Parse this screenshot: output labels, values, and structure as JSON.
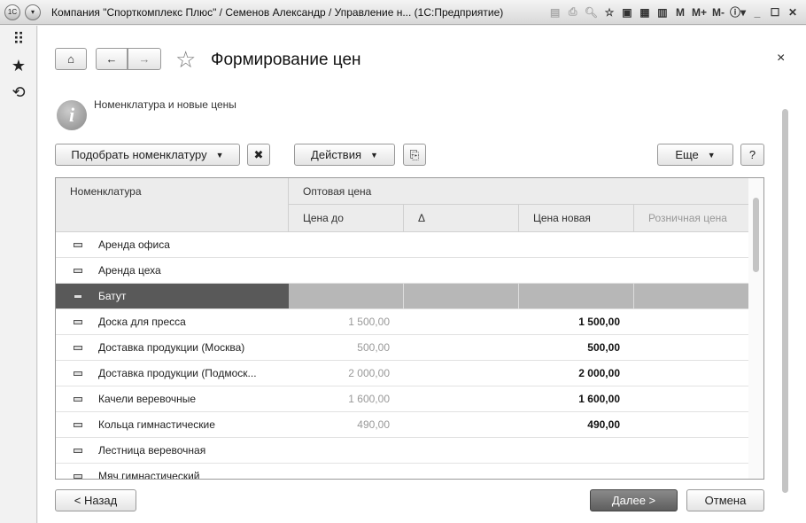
{
  "window": {
    "title": "Компания \"Спорткомплекс Плюс\" / Семенов Александр / Управление н... (1С:Предприятие)",
    "tools": [
      "M",
      "M+",
      "M-"
    ]
  },
  "form": {
    "title": "Формирование цен",
    "info": "Номенклатура и новые цены",
    "close": "×"
  },
  "toolbar": {
    "pick": "Подобрать номенклатуру",
    "actions": "Действия",
    "more": "Еще",
    "help": "?"
  },
  "table": {
    "headers": {
      "name": "Номенклатура",
      "wholesale": "Оптовая цена",
      "price_before": "Цена до",
      "delta": "Δ",
      "price_new": "Цена новая",
      "retail": "Розничная цена"
    },
    "rows": [
      {
        "name": "Аренда офиса",
        "before": "",
        "new": ""
      },
      {
        "name": "Аренда цеха",
        "before": "",
        "new": ""
      },
      {
        "name": "Батут",
        "before": "",
        "new": "",
        "selected": true
      },
      {
        "name": "Доска для пресса",
        "before": "1 500,00",
        "new": "1 500,00"
      },
      {
        "name": "Доставка продукции (Москва)",
        "before": "500,00",
        "new": "500,00"
      },
      {
        "name": "Доставка продукции (Подмоск...",
        "before": "2 000,00",
        "new": "2 000,00"
      },
      {
        "name": "Качели веревочные",
        "before": "1 600,00",
        "new": "1 600,00"
      },
      {
        "name": "Кольца гимнастические",
        "before": "490,00",
        "new": "490,00"
      },
      {
        "name": "Лестница веревочная",
        "before": "",
        "new": ""
      },
      {
        "name": "Мяч гимнастический",
        "before": "",
        "new": ""
      }
    ]
  },
  "footer": {
    "back": "< Назад",
    "next": "Далее >",
    "cancel": "Отмена"
  }
}
